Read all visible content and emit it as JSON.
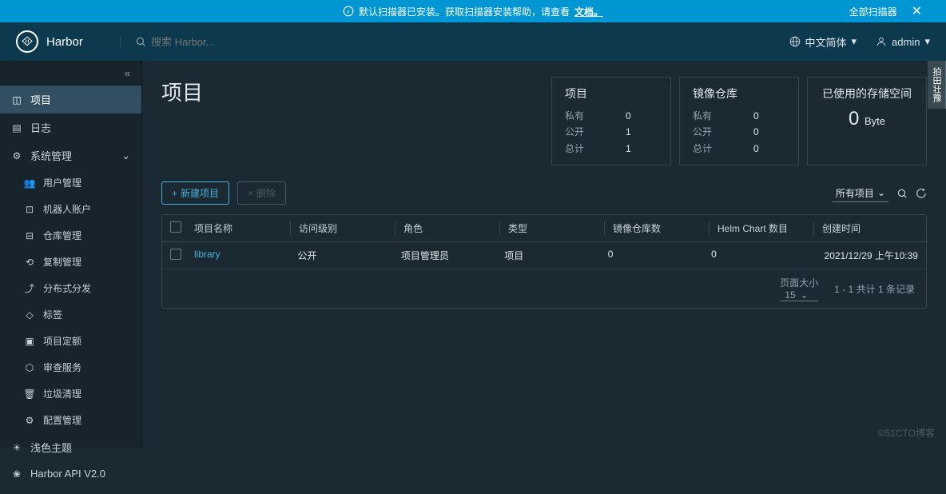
{
  "banner": {
    "text": "默认扫描器已安装。获取扫描器安装帮助，请查看",
    "link": "文档。",
    "all_scanners": "全部扫描器"
  },
  "header": {
    "app_name": "Harbor",
    "search_placeholder": "搜索 Harbor...",
    "language": "中文简体",
    "user": "admin"
  },
  "sidebar": {
    "projects": "项目",
    "logs": "日志",
    "system": "系统管理",
    "sys": {
      "users": "用户管理",
      "robots": "机器人账户",
      "repos": "仓库管理",
      "replication": "复制管理",
      "distribution": "分布式分发",
      "labels": "标签",
      "quotas": "项目定额",
      "audit": "审查服务",
      "gc": "垃圾清理",
      "config": "配置管理"
    },
    "footer": {
      "theme": "浅色主题",
      "api": "Harbor API V2.0"
    }
  },
  "page": {
    "title": "项目",
    "stats": {
      "projects": {
        "title": "项目",
        "private_label": "私有",
        "private": "0",
        "public_label": "公开",
        "public": "1",
        "total_label": "总计",
        "total": "1"
      },
      "repos": {
        "title": "镜像仓库",
        "private_label": "私有",
        "private": "0",
        "public_label": "公开",
        "public": "0",
        "total_label": "总计",
        "total": "0"
      },
      "storage": {
        "title": "已使用的存储空间",
        "value": "0",
        "unit": "Byte"
      }
    },
    "toolbar": {
      "new_project": "新建项目",
      "delete": "删除",
      "filter": "所有项目"
    },
    "table": {
      "headers": {
        "name": "项目名称",
        "access": "访问级别",
        "role": "角色",
        "type": "类型",
        "repo_count": "镜像仓库数",
        "chart_count": "Helm Chart 数目",
        "created": "创建时间"
      },
      "rows": [
        {
          "name": "library",
          "access": "公开",
          "role": "项目管理员",
          "type": "项目",
          "repo_count": "0",
          "chart_count": "0",
          "created": "2021/12/29 上午10:39"
        }
      ],
      "footer": {
        "page_size_label": "页面大小",
        "page_size": "15",
        "range": "1 - 1 共计 1 条记录"
      }
    }
  },
  "side_tab": "拍田壮豫",
  "watermark": "©51CTO博客"
}
